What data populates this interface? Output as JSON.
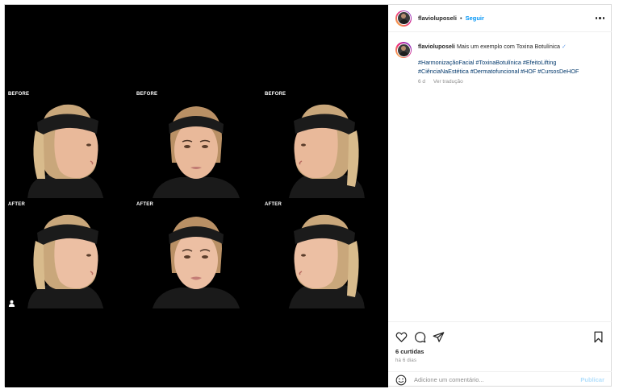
{
  "post": {
    "username": "flavioluposeli",
    "dot": "•",
    "follow_label": "Seguir",
    "more_icon": "more-horizontal-icon"
  },
  "caption": {
    "username": "flavioluposeli",
    "text": "Mais um exemplo com Toxina Botulínica",
    "verified_glyph": "✓",
    "hashtags_line1": "#HarmonizaçãoFacial #ToxinaBotulínica #EfeitoLifting",
    "hashtags_line2": "#CiênciaNaEstética #Dermatofuncional #HOF #CursosDeHOF",
    "age": "6 d",
    "translate": "Ver tradução"
  },
  "media": {
    "labels": [
      "BEFORE",
      "BEFORE",
      "BEFORE",
      "AFTER",
      "AFTER",
      "AFTER"
    ],
    "colors": {
      "background": "#000000",
      "skin": "#e9b99a",
      "hair": "#c9a77b",
      "headband": "#1b1b1b"
    }
  },
  "actions": {
    "icons": [
      "heart-icon",
      "comment-icon",
      "share-icon",
      "bookmark-icon"
    ],
    "likes": "6 curtidas",
    "time_ago": "há 6 dias"
  },
  "comment": {
    "placeholder": "Adicione um comentário...",
    "post_label": "Publicar"
  },
  "colors": {
    "accent": "#0095f6",
    "link": "#00376b",
    "muted": "#8e8e8e"
  }
}
